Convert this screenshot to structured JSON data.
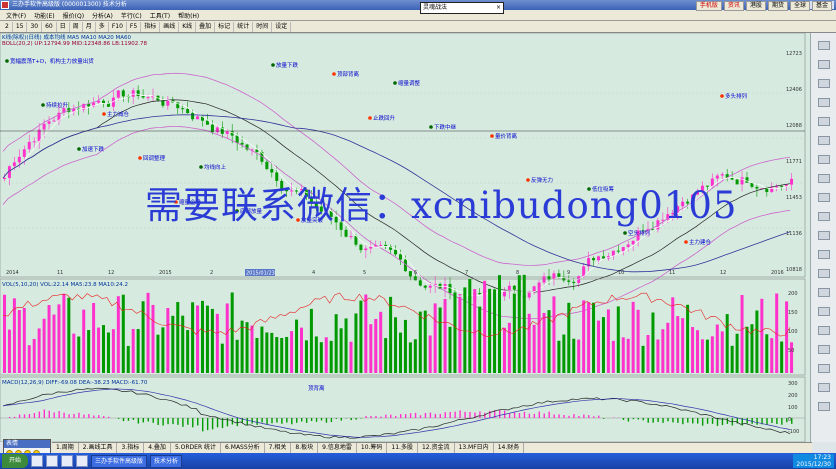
{
  "window": {
    "title": "三办手软件高级版 (000001300) 技术分析"
  },
  "menu": [
    "文件(F)",
    "功能(E)",
    "报价(Q)",
    "分析(A)",
    "芊行(C)",
    "工具(T)",
    "帮助(H)"
  ],
  "toolbar": [
    "2",
    "15",
    "30",
    "60",
    "日",
    "周",
    "月",
    "多",
    "F10",
    "F5",
    "指标",
    "画线",
    "K线",
    "叠加",
    "标记",
    "统计",
    "时间",
    "设定"
  ],
  "search": {
    "value": "灵魂战法",
    "close": "×"
  },
  "right_tabs": [
    "手机版",
    "资讯",
    "港股",
    "期货",
    "全球",
    "基金"
  ],
  "chart": {
    "header": "K线(除权)(日线) 成本均线 MA5 MA10 MA20 MA60",
    "header2": "BOLL(20,2) UP:12794.99 MID:12348.86 LB:11902.78",
    "price_axis": [
      "12723",
      "12406",
      "12088",
      "11771",
      "11453",
      "11136",
      "10818"
    ],
    "date_axis": [
      "2014",
      "11",
      "12",
      "2015",
      "2",
      "3",
      "4",
      "5",
      "6",
      "7",
      "8",
      "9",
      "10",
      "11",
      "12",
      "2016"
    ],
    "date_pill": "2015/01/23",
    "annotations": [
      "宽幅震荡T+D，机构主力放量出货",
      "主力减仓",
      "均线向上",
      "放量突破",
      "缩量调整",
      "量价背离",
      "低位吸筹",
      "主力建仓",
      "持续拉升",
      "回调整理",
      "底部放量",
      "顶部背离",
      "下跌中继",
      "反弹无力",
      "空头排列",
      "多头排列",
      "加速下跌",
      "缩量企稳",
      "放量下跌",
      "止跌回升"
    ]
  },
  "volume": {
    "header": "VOL(5,10,20) VOL:22.14 MA5:23.8 MA10:24.2",
    "axis": [
      "200",
      "150",
      "100",
      "50"
    ]
  },
  "macd": {
    "header": "MACD(12,26,9) DIFF:-69.08 DEA:-38.23 MACD:-61.70",
    "axis": [
      "300",
      "200",
      "100",
      "0",
      "-100"
    ],
    "label": "顶背离"
  },
  "watermark": "需要联系微信：xcnibudong0105",
  "popup": {
    "title": "表情"
  },
  "bottom_tabs": [
    "1.周期",
    "2.画线工具",
    "3.指标",
    "4.叠加",
    "5.ORDER 统计",
    "6.MASS分析",
    "7.相关",
    "8.板块",
    "9.信息地雷",
    "10.筹码",
    "11.多股",
    "12.资金流",
    "13.MF日内",
    "14.财务"
  ],
  "taskbar": {
    "start": "开始",
    "items": [
      "三办手软件高级版",
      "技术分析"
    ],
    "time": "17:23",
    "date": "2015/12/30"
  },
  "colors": {
    "bg": "#d6eadf",
    "up": "#009900",
    "down": "#ff33cc",
    "line_white": "#ffffff",
    "line_dark": "#222222",
    "line_red": "#e82020"
  }
}
